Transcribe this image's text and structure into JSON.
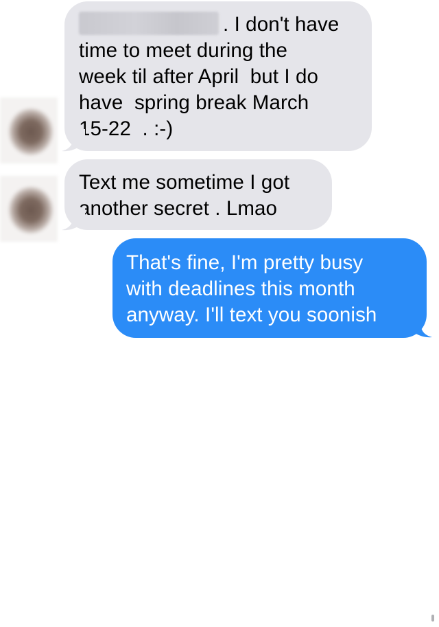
{
  "conversation": {
    "messages": [
      {
        "direction": "incoming",
        "redacted_name": true,
        "lines": [
          ". I don't have",
          "time to meet during the",
          "week til after April  but I do",
          "have  spring break March",
          "15-22  . :-)"
        ]
      },
      {
        "direction": "incoming",
        "lines": [
          "Text me sometime I got",
          "another secret . Lmao"
        ]
      },
      {
        "direction": "outgoing",
        "lines": [
          "That's fine, I'm pretty busy",
          "with deadlines this month",
          "anyway. I'll text you soonish"
        ]
      }
    ]
  },
  "colors": {
    "incoming_bubble": "#e5e5ea",
    "outgoing_bubble": "#2b8cf7",
    "incoming_text": "#000000",
    "outgoing_text": "#ffffff",
    "background": "#ffffff"
  }
}
